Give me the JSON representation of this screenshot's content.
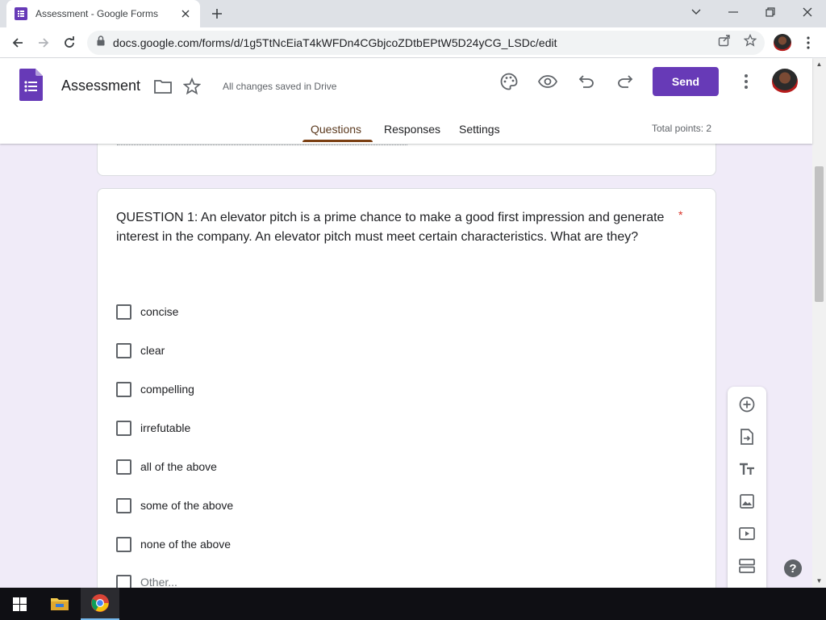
{
  "browser": {
    "tab_title": "Assessment - Google Forms",
    "url": "docs.google.com/forms/d/1g5TtNcEiaT4kWFDn4CGbjcoZDtbEPtW5D24yCG_LSDc/edit"
  },
  "header": {
    "doc_title": "Assessment",
    "saved_status": "All changes saved in Drive",
    "send_label": "Send",
    "tabs": [
      {
        "label": "Questions",
        "active": true
      },
      {
        "label": "Responses",
        "active": false
      },
      {
        "label": "Settings",
        "active": false
      }
    ],
    "total_points": "Total points: 2"
  },
  "question": {
    "text": "QUESTION 1:  An elevator pitch is a prime chance to make a good first impression and generate interest in the company. An elevator pitch must meet certain characteristics. What are they?",
    "required_marker": "*",
    "options": [
      {
        "label": "concise"
      },
      {
        "label": "clear"
      },
      {
        "label": "compelling"
      },
      {
        "label": "irrefutable"
      },
      {
        "label": "all of the above"
      },
      {
        "label": "some of the above"
      },
      {
        "label": "none of the above"
      },
      {
        "label": "Other..."
      }
    ]
  },
  "side_toolbar": [
    "add-question-icon",
    "import-questions-icon",
    "add-title-icon",
    "add-image-icon",
    "add-video-icon",
    "add-section-icon"
  ],
  "help_label": "?",
  "colors": {
    "accent": "#673ab7",
    "background": "#f0ebf8",
    "tab_indicator": "#7b3f12",
    "required": "#d93025"
  }
}
